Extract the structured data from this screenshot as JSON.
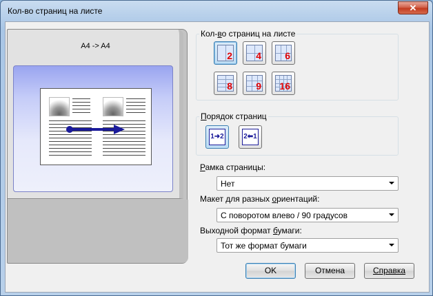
{
  "window": {
    "title": "Кол-во страниц на листе",
    "close_label": "✕"
  },
  "preview": {
    "label": "A4 -> A4"
  },
  "nup_group": {
    "legend_pre": "Кол-",
    "legend_u": "в",
    "legend_post": "о страниц на листе",
    "options": [
      "2",
      "4",
      "6",
      "8",
      "9",
      "16"
    ],
    "selected": "2"
  },
  "order_group": {
    "legend_pre": "",
    "legend_u": "П",
    "legend_post": "орядок страниц",
    "options": [
      {
        "text": "1➜2",
        "selected": true
      },
      {
        "text": "2⬅1",
        "selected": false
      }
    ]
  },
  "border": {
    "label_pre": "",
    "label_u": "Р",
    "label_post": "амка страницы:",
    "value": "Нет"
  },
  "orientation": {
    "label_pre": "Макет для разных ",
    "label_u": "о",
    "label_post": "риентаций:",
    "value": "С поворотом влево / 90 градусов"
  },
  "paper": {
    "label_pre": "Выходной формат ",
    "label_u": "б",
    "label_post": "умаги:",
    "value": "Тот же формат бумаги"
  },
  "buttons": {
    "ok": "OK",
    "cancel": "Отмена",
    "help": "Справка"
  },
  "colors": {
    "selected_border": "#3c7fb1",
    "number_red": "#e00000",
    "arrow_blue": "#1b1b9a"
  }
}
